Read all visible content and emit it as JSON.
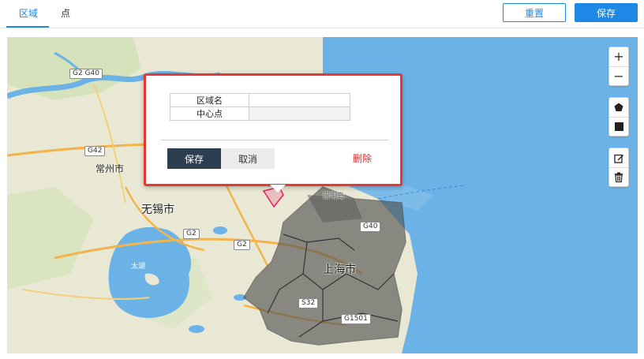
{
  "tabs": [
    {
      "label": "区域",
      "active": true
    },
    {
      "label": "点",
      "active": false
    }
  ],
  "toolbar": {
    "reset_label": "重置",
    "save_label": "保存"
  },
  "map": {
    "places": {
      "changzhou": "常州市",
      "wuxi": "无锡市",
      "shanghai": "上海市",
      "taihu": "太湖",
      "chongming": "崇明岛"
    },
    "roads": {
      "g2g40": "G2 G40",
      "g42": "G42",
      "g2": "G2",
      "g2b": "G2",
      "g40": "G40",
      "s32": "S32",
      "g1501": "G1501"
    },
    "controls": {
      "zoom_in": "+",
      "zoom_out": "−",
      "polygon_icon": "pentagon-icon",
      "rectangle_icon": "square-icon",
      "edit_icon": "edit-icon",
      "delete_icon": "trash-icon"
    },
    "colors": {
      "sea": "#6bb3e6",
      "land": "#e9e8d4",
      "region_fill": "#555555",
      "region_border": "#e53935"
    }
  },
  "popup": {
    "fields": [
      {
        "label": "区域名",
        "value": ""
      },
      {
        "label": "中心点",
        "value": ""
      }
    ],
    "save_label": "保存",
    "cancel_label": "取消",
    "delete_label": "删除"
  }
}
